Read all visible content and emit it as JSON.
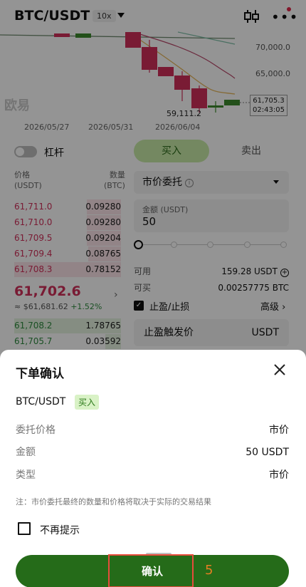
{
  "header": {
    "pair": "BTC/USDT",
    "leverage": "10x"
  },
  "chart": {
    "price_ticks": [
      "70,000.0",
      "65,000.0"
    ],
    "dates": [
      "2026/05/27",
      "2026/05/31",
      "2026/06/04"
    ],
    "watermark": "欧易",
    "low_price": "59,111.2",
    "last_price": "61,705.3",
    "countdown": "02:43:05"
  },
  "margin": {
    "label": "杠杆"
  },
  "orderbook": {
    "price_header": "价格",
    "price_unit": "(USDT)",
    "qty_header": "数量",
    "qty_unit": "(BTC)",
    "asks": [
      {
        "price": "61,711.0",
        "qty": "0.09280"
      },
      {
        "price": "61,710.0",
        "qty": "0.09280"
      },
      {
        "price": "61,709.5",
        "qty": "0.09204"
      },
      {
        "price": "61,709.4",
        "qty": "0.08765"
      },
      {
        "price": "61,708.3",
        "qty": "0.78152"
      }
    ],
    "mid_price": "61,702.6",
    "mid_fiat": "≈ $61,681.62",
    "mid_change": "+1.52%",
    "bids": [
      {
        "price": "61,708.2",
        "qty": "1.78765"
      },
      {
        "price": "61,705.7",
        "qty": "0.03592"
      }
    ]
  },
  "trade_form": {
    "buy_tab": "买入",
    "sell_tab": "卖出",
    "order_type": "市价委托",
    "amount_label": "金额 (USDT)",
    "amount_value": "50",
    "available_label": "可用",
    "available_value": "159.28 USDT",
    "buyable_label": "可买",
    "buyable_value": "0.00257775 BTC",
    "tpsl_label": "止盈/止损",
    "advanced_label": "高级 ›",
    "tp_trigger_label": "止盈触发价",
    "tp_trigger_unit": "USDT"
  },
  "confirm_sheet": {
    "title": "下单确认",
    "pair": "BTC/USDT",
    "side": "买入",
    "rows": [
      {
        "label": "委托价格",
        "value": "市价"
      },
      {
        "label": "金额",
        "value": "50 USDT"
      },
      {
        "label": "类型",
        "value": "市价"
      }
    ],
    "note": "注：市价委托最终的数量和价格将取决于实际的交易结果",
    "dont_remind_label": "不再提示",
    "confirm_label": "确认",
    "step_number": "5"
  },
  "colors": {
    "buy_green": "#256b19",
    "ask_red": "#d0305a",
    "annotation_red": "#e74c3c",
    "annotation_orange": "#e67e22"
  }
}
